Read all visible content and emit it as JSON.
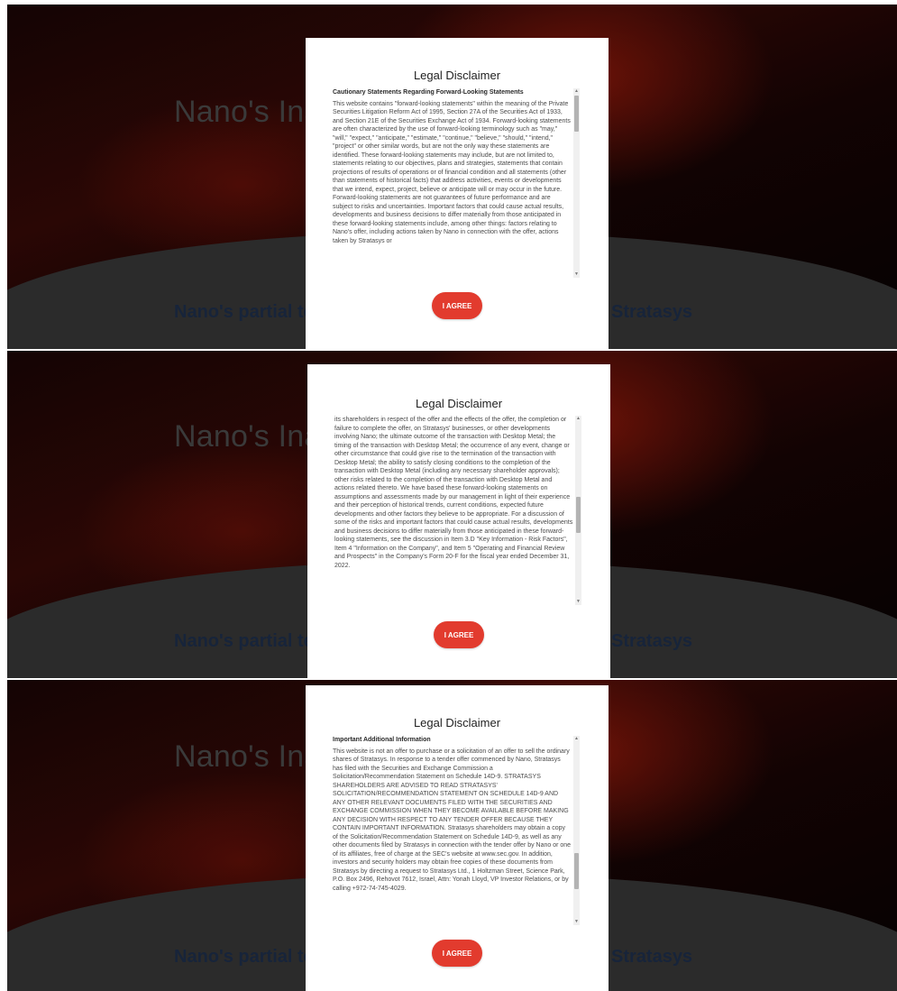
{
  "background": {
    "heading": "Nano's Ina",
    "subheading_left": "Nano's partial te",
    "subheading_right": "Stratasys"
  },
  "modals": [
    {
      "title": "Legal Disclaimer",
      "section_heading": "Cautionary Statements Regarding Forward-Looking Statements",
      "body": "This website contains \"forward-looking statements\" within the meaning of the Private Securities Litigation Reform Act of 1995, Section 27A of the Securities Act of 1933, and Section 21E of the Securities Exchange Act of 1934. Forward-looking statements are often characterized by the use of forward-looking terminology such as \"may,\" \"will,\" \"expect,\" \"anticipate,\" \"estimate,\" \"continue,\" \"believe,\" \"should,\" \"intend,\" \"project\" or other similar words, but are not the only way these statements are identified. These forward-looking statements may include, but are not limited to, statements relating to our objectives, plans and strategies, statements that contain projections of results of operations or of financial condition and all statements (other than statements of historical facts) that address activities, events or developments that we intend, expect, project, believe or anticipate will or may occur in the future. Forward-looking statements are not guarantees of future performance and are subject to risks and uncertainties. Important factors that could cause actual results, developments and business decisions to differ materially from those anticipated in these forward-looking statements include, among other things: factors relating to Nano's offer, including actions taken by Nano in connection with the offer, actions taken by Stratasys or",
      "button_label": "I AGREE"
    },
    {
      "title": "Legal Disclaimer",
      "section_heading": "",
      "body": "its shareholders in respect of the offer and the effects of the offer, the completion or failure to complete the offer, on Stratasys' businesses, or other developments involving Nano; the ultimate outcome of the transaction with Desktop Metal; the timing of the transaction with Desktop Metal; the occurrence of any event, change or other circumstance that could give rise to the termination of the transaction with Desktop Metal; the ability to satisfy closing conditions to the completion of the transaction with Desktop Metal (including any necessary shareholder approvals); other risks related to the completion of the transaction with Desktop Metal and actions related thereto. We have based these forward-looking statements on assumptions and assessments made by our management in light of their experience and their perception of historical trends, current conditions, expected future developments and other factors they believe to be appropriate. For a discussion of some of the risks and important factors that could cause actual results, developments and business decisions to differ materially from those anticipated in these forward-looking statements, see the discussion in Item 3.D \"Key Information - Risk Factors\", Item 4 \"Information on the Company\", and Item 5 \"Operating and Financial Review and Prospects\" in the Company's Form 20-F for the fiscal year ended December 31, 2022.",
      "button_label": "I AGREE"
    },
    {
      "title": "Legal Disclaimer",
      "section_heading": "Important Additional Information",
      "body": "This website is not an offer to purchase or a solicitation of an offer to sell the ordinary shares of Stratasys. In response to a tender offer commenced by Nano, Stratasys has filed with the Securities and Exchange Commission a Solicitation/Recommendation Statement on Schedule 14D-9. STRATASYS SHAREHOLDERS ARE ADVISED TO READ STRATASYS' SOLICITATION/RECOMMENDATION STATEMENT ON SCHEDULE 14D-9 AND ANY OTHER RELEVANT DOCUMENTS FILED WITH THE SECURITIES AND EXCHANGE COMMISSION WHEN THEY BECOME AVAILABLE BEFORE MAKING ANY DECISION WITH RESPECT TO ANY TENDER OFFER BECAUSE THEY CONTAIN IMPORTANT INFORMATION. Stratasys shareholders may obtain a copy of the Solicitation/Recommendation Statement on Schedule 14D-9, as well as any other documents filed by Stratasys in connection with the tender offer by Nano or one of its affiliates, free of charge at the SEC's website at www.sec.gov. In addition, investors and security holders may obtain free copies of these documents from Stratasys by directing a request to Stratasys Ltd., 1 Holtzman Street, Science Park, P.O. Box 2496, Rehovot 7612, Israel, Attn: Yonah Lloyd, VP Investor Relations, or by calling +972-74-745-4029.",
      "button_label": "I AGREE"
    }
  ],
  "colors": {
    "accent": "#e23b2e",
    "modal_bg": "#ffffff",
    "overlay": "#000000"
  },
  "scroll_positions": [
    0.0,
    0.35,
    0.62
  ]
}
